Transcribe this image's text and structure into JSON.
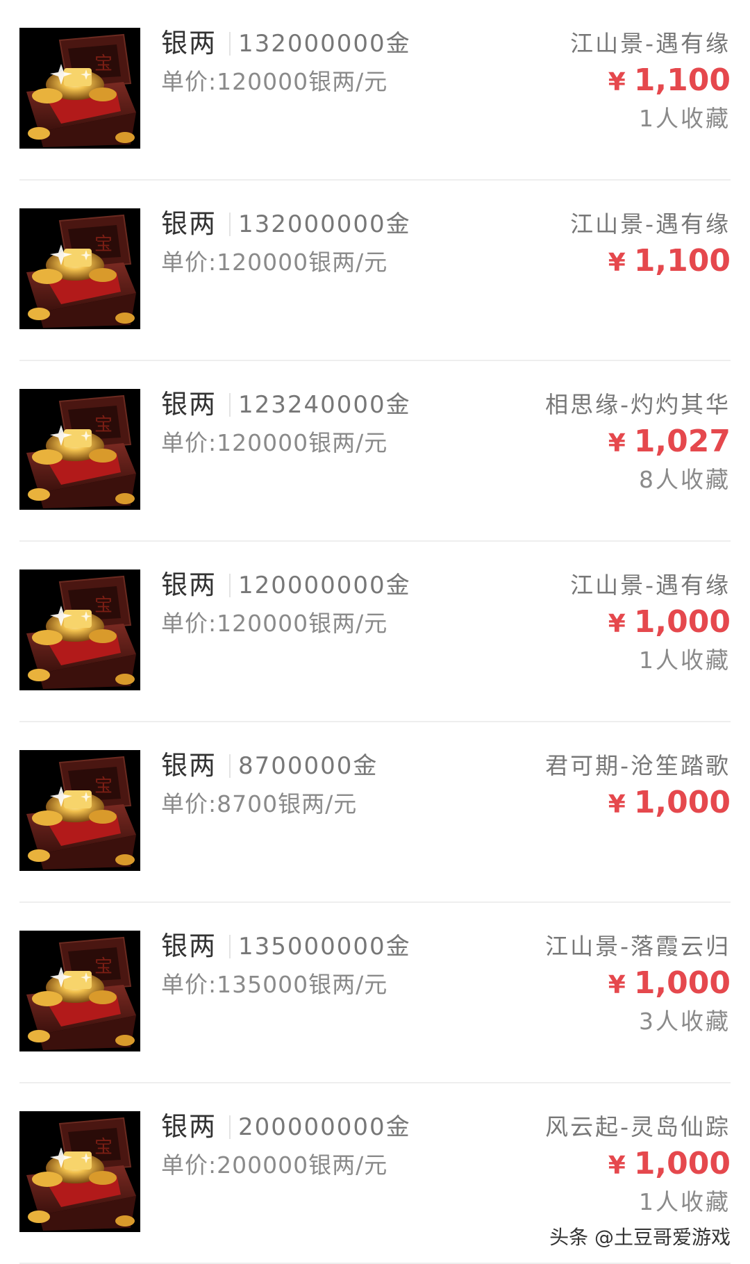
{
  "listings": [
    {
      "name": "银两",
      "amount": "132000000金",
      "unit_price": "单价:120000银两/元",
      "server": "江山景-遇有缘",
      "currency": "¥",
      "price": "1,100",
      "favorites": "1人收藏"
    },
    {
      "name": "银两",
      "amount": "132000000金",
      "unit_price": "单价:120000银两/元",
      "server": "江山景-遇有缘",
      "currency": "¥",
      "price": "1,100",
      "favorites": ""
    },
    {
      "name": "银两",
      "amount": "123240000金",
      "unit_price": "单价:120000银两/元",
      "server": "相思缘-灼灼其华",
      "currency": "¥",
      "price": "1,027",
      "favorites": "8人收藏"
    },
    {
      "name": "银两",
      "amount": "120000000金",
      "unit_price": "单价:120000银两/元",
      "server": "江山景-遇有缘",
      "currency": "¥",
      "price": "1,000",
      "favorites": "1人收藏"
    },
    {
      "name": "银两",
      "amount": "8700000金",
      "unit_price": "单价:8700银两/元",
      "server": "君可期-沧笙踏歌",
      "currency": "¥",
      "price": "1,000",
      "favorites": ""
    },
    {
      "name": "银两",
      "amount": "135000000金",
      "unit_price": "单价:135000银两/元",
      "server": "江山景-落霞云归",
      "currency": "¥",
      "price": "1,000",
      "favorites": "3人收藏"
    },
    {
      "name": "银两",
      "amount": "200000000金",
      "unit_price": "单价:200000银两/元",
      "server": "风云起-灵岛仙踪",
      "currency": "¥",
      "price": "1,000",
      "favorites": "1人收藏"
    }
  ],
  "thumbnail_icon": "treasure-chest-icon",
  "watermark": "头条 @土豆哥爱游戏",
  "colors": {
    "price": "#e5484d",
    "primary_text": "#333333",
    "secondary_text": "#777777",
    "divider": "#eeeeee"
  }
}
